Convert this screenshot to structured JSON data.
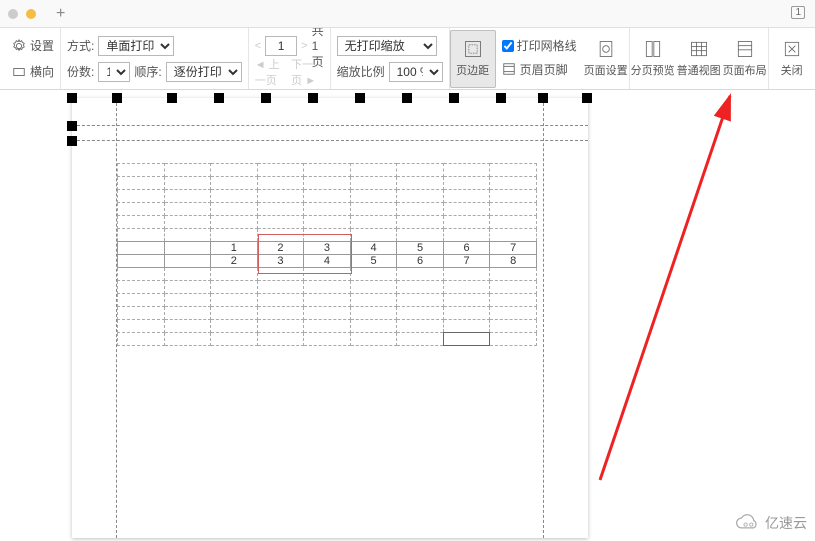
{
  "titlebar": {
    "plus": "+",
    "tab_count": "1"
  },
  "toolbar": {
    "settings_label": "设置",
    "orient_label": "横向",
    "mode_label": "方式:",
    "mode_value": "单面打印",
    "copies_label": "份数:",
    "copies_value": "1",
    "order_label": "顺序:",
    "order_value": "逐份打印",
    "page_current": "1",
    "page_total_label": "共 1 页",
    "prev_page": "上一页",
    "next_page": "下一页",
    "scale_label": "无打印缩放",
    "zoom_label": "缩放比例",
    "zoom_value": "100 %",
    "margins": "页边距",
    "gridlines": "打印网格线",
    "header_footer": "页眉页脚",
    "page_setup": "页面设置",
    "page_break": "分页预览",
    "normal_view": "普通视图",
    "page_layout": "页面布局",
    "close": "关闭"
  },
  "sheet": {
    "row1": [
      "1",
      "2",
      "3",
      "4",
      "5",
      "6",
      "7"
    ],
    "row2": [
      "2",
      "3",
      "4",
      "5",
      "6",
      "7",
      "8"
    ]
  },
  "watermark": "亿速云"
}
